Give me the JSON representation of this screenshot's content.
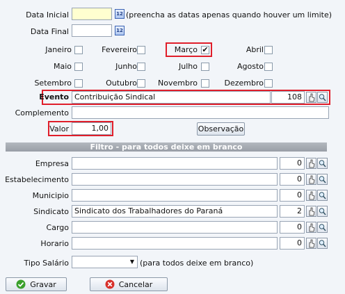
{
  "dates": {
    "start_label": "Data Inicial",
    "start_value": "",
    "hint": "(preencha as datas apenas quando houver um limite)",
    "end_label": "Data Final",
    "end_value": "",
    "calendar_text": "12"
  },
  "months": [
    {
      "label": "Janeiro",
      "checked": false
    },
    {
      "label": "Fevereiro",
      "checked": false
    },
    {
      "label": "Março",
      "checked": true
    },
    {
      "label": "Abril",
      "checked": false
    },
    {
      "label": "Maio",
      "checked": false
    },
    {
      "label": "Junho",
      "checked": false
    },
    {
      "label": "Julho",
      "checked": false
    },
    {
      "label": "Agosto",
      "checked": false
    },
    {
      "label": "Setembro",
      "checked": false
    },
    {
      "label": "Outubro",
      "checked": false
    },
    {
      "label": "Novembro",
      "checked": false
    },
    {
      "label": "Dezembro",
      "checked": false
    }
  ],
  "evento": {
    "label": "Evento",
    "value": "Contribuição Sindical",
    "code": "108"
  },
  "complemento": {
    "label": "Complemento",
    "value": ""
  },
  "valor": {
    "label": "Valor",
    "value": "1,00"
  },
  "observacao_label": "Observação",
  "filter_title": "Filtro - para todos deixe em branco",
  "filters": [
    {
      "label": "Empresa",
      "value": "",
      "code": "0"
    },
    {
      "label": "Estabelecimento",
      "value": "",
      "code": "0"
    },
    {
      "label": "Municipio",
      "value": "",
      "code": "0"
    },
    {
      "label": "Sindicato",
      "value": "Sindicato dos Trabalhadores do Paraná",
      "code": "2"
    },
    {
      "label": "Cargo",
      "value": "",
      "code": "0"
    },
    {
      "label": "Horario",
      "value": "",
      "code": "0"
    }
  ],
  "tipo_salario": {
    "label": "Tipo Salário",
    "value": "",
    "hint": "(para todos deixe em branco)"
  },
  "buttons": {
    "save": "Gravar",
    "cancel": "Cancelar"
  },
  "colors": {
    "highlight": "#e01e2a",
    "section_header": "#a4a9b0",
    "save_green": "#3aa02c",
    "cancel_red": "#d8302a"
  }
}
